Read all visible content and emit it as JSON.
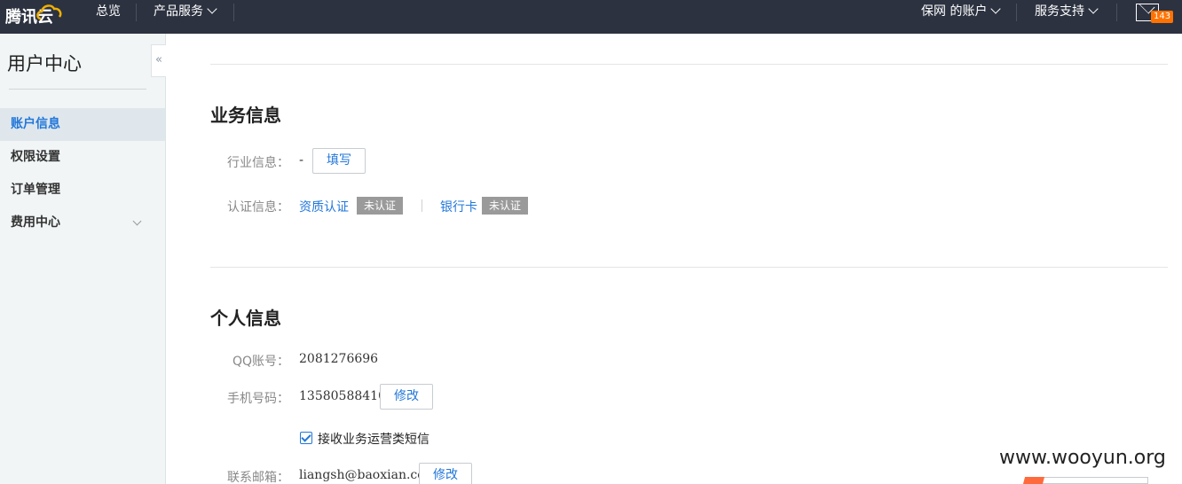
{
  "topbar": {
    "logo_text": "腾讯云",
    "nav": [
      {
        "label": "总览"
      },
      {
        "label": "产品服务"
      }
    ],
    "account_label": "保网 的账户",
    "support_label": "服务支持",
    "mail_count": "143"
  },
  "sidebar": {
    "title": "用户中心",
    "collapse_glyph": "«",
    "items": [
      {
        "label": "账户信息",
        "active": true
      },
      {
        "label": "权限设置"
      },
      {
        "label": "订单管理"
      },
      {
        "label": "费用中心"
      }
    ]
  },
  "business": {
    "title": "业务信息",
    "industry_label": "行业信息：",
    "industry_value": "-",
    "fill_button": "填写",
    "cert_label": "认证信息：",
    "qualification_link": "资质认证",
    "qualification_status": "未认证",
    "bankcard_link": "银行卡",
    "bankcard_status": "未认证"
  },
  "personal": {
    "title": "个人信息",
    "qq_label": "QQ账号：",
    "qq_value": "2081276696",
    "phone_label": "手机号码：",
    "phone_value": "13580588410",
    "phone_edit": "修改",
    "sms_checkbox_label": "接收业务运营类短信",
    "sms_checked": true,
    "email_label": "联系邮箱：",
    "email_value": "liangsh@baoxian.com",
    "email_edit": "修改"
  },
  "watermark": "www.wooyun.org",
  "colors": {
    "topbar_bg": "#2c3240",
    "accent": "#2277da",
    "badge_orange": "#ff7200",
    "sidebar_bg": "#f1f5f6",
    "status_badge": "#9a9a9a"
  }
}
